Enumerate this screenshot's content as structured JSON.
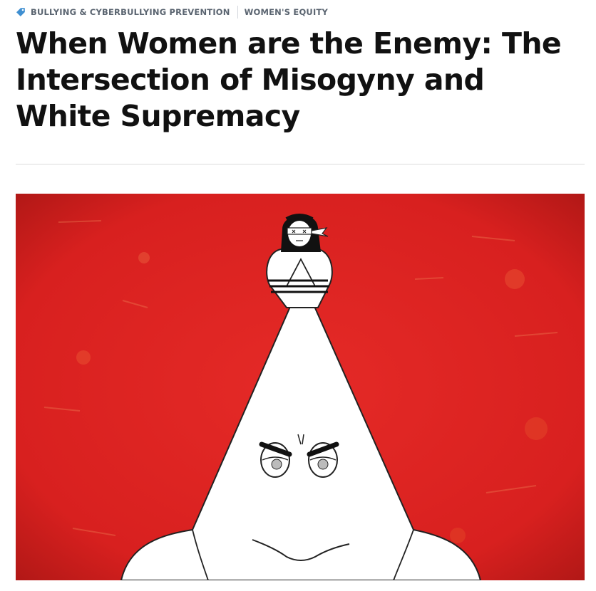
{
  "categories": {
    "tag_icon": "tag-icon",
    "items": [
      {
        "label": "BULLYING & CYBERBULLYING PREVENTION"
      },
      {
        "label": "WOMEN'S EQUITY"
      }
    ]
  },
  "article": {
    "title": "When Women are the Enemy: The Intersection of Misogyny and White Supremacy"
  },
  "hero_image": {
    "background_color": "#d8201f",
    "figure_color": "#ffffff"
  },
  "colors": {
    "tag_text": "#5a6470",
    "tag_icon": "#3f8fd1",
    "title_text": "#111111"
  }
}
